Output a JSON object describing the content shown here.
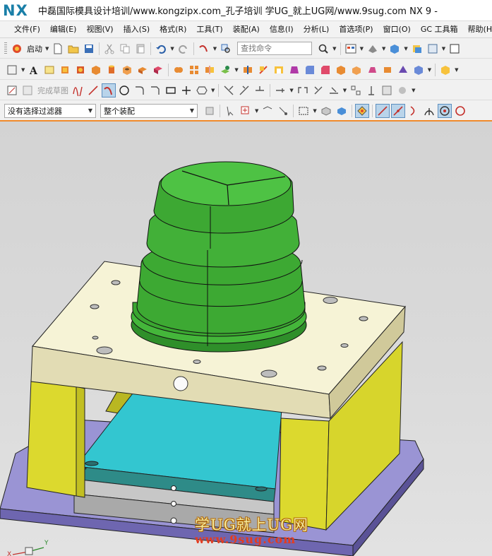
{
  "window": {
    "logo": "NX",
    "title": "中磊国际模具设计培训/www.kongzipx.com_孔子培训  学UG_就上UG网/www.9sug.com NX 9 -"
  },
  "menu": {
    "items": [
      "文件(F)",
      "编辑(E)",
      "视图(V)",
      "插入(S)",
      "格式(R)",
      "工具(T)",
      "装配(A)",
      "信息(I)",
      "分析(L)",
      "首选项(P)",
      "窗口(O)",
      "GC 工具箱",
      "帮助(H)"
    ]
  },
  "standard_toolbar": {
    "start_label": "启动",
    "search_placeholder": "查找命令"
  },
  "sketch_toolbar": {
    "finish_sketch_label": "完成草图"
  },
  "selection_bar": {
    "filter_value": "没有选择过滤器",
    "scope_value": "整个装配"
  },
  "viewport": {
    "watermark_title": "学UG就上UG网",
    "watermark_url": "www.9sug.com",
    "triad": {
      "x_label": "X",
      "y_label": "Y"
    },
    "colors": {
      "accent_border": "#f08a2c",
      "top_plate": "#f6f3d6",
      "plate_side": "#e2dcb4",
      "support_blocks": "#dbd82a",
      "cavity_insert": "#36c2cc",
      "base_plate": "#8c85c8",
      "core_green": "#46b436"
    }
  }
}
